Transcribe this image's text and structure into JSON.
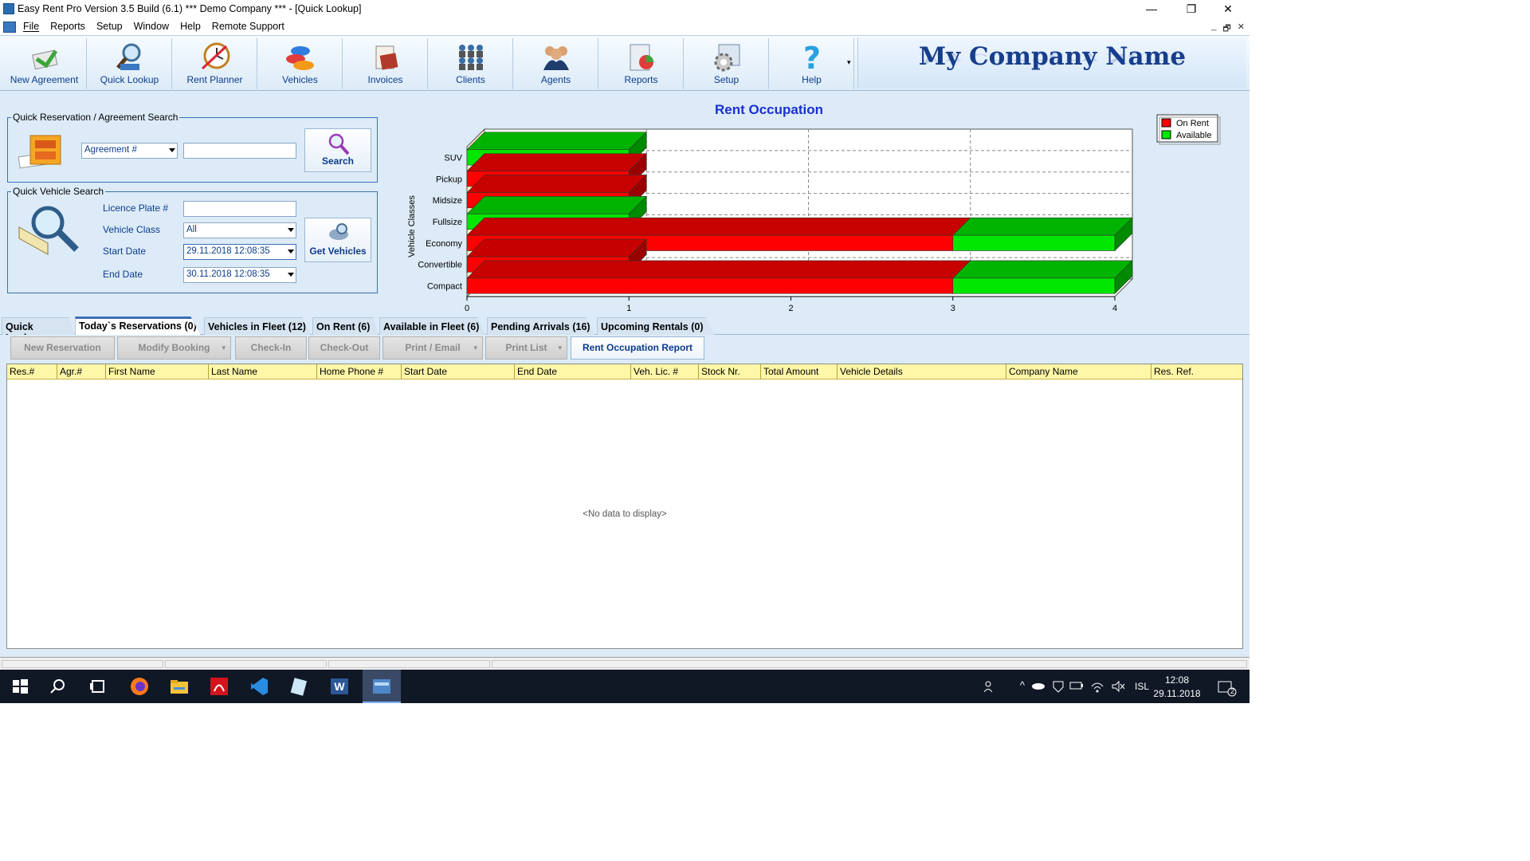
{
  "window": {
    "title": "Easy Rent Pro  Version 3.5 Build (6.1)  *** Demo Company *** - [Quick Lookup]",
    "min": "—",
    "max": "❐",
    "close": "✕"
  },
  "menu": [
    "File",
    "Reports",
    "Setup",
    "Window",
    "Help",
    "Remote Support"
  ],
  "mdi_controls": [
    "_",
    "🗗",
    "✕"
  ],
  "toolbar": {
    "buttons": [
      {
        "label": "New Agreement",
        "icon": "new-agreement-icon"
      },
      {
        "label": "Quick Lookup",
        "icon": "quick-lookup-icon"
      },
      {
        "label": "Rent Planner",
        "icon": "rent-planner-icon"
      },
      {
        "label": "Vehicles",
        "icon": "vehicles-icon"
      },
      {
        "label": "Invoices",
        "icon": "invoices-icon"
      },
      {
        "label": "Clients",
        "icon": "clients-icon"
      },
      {
        "label": "Agents",
        "icon": "agents-icon"
      },
      {
        "label": "Reports",
        "icon": "reports-icon"
      },
      {
        "label": "Setup",
        "icon": "setup-icon"
      },
      {
        "label": "Help",
        "icon": "help-icon"
      }
    ],
    "overflow": "▾",
    "company_name": "My Company Name"
  },
  "quick_search": {
    "legend": "Quick Reservation / Agreement Search",
    "type_value": "Agreement #",
    "search_value": "",
    "search_button": "Search"
  },
  "vehicle_search": {
    "legend": "Quick  Vehicle Search",
    "licence_label": "Licence Plate #",
    "licence_value": "",
    "class_label": "Vehicle Class",
    "class_value": "All",
    "start_label": "Start Date",
    "start_value": "29.11.2018 12:08:35",
    "end_label": "End Date",
    "end_value": "30.11.2018 12:08:35",
    "get_button": "Get Vehicles"
  },
  "chart_data": {
    "type": "bar",
    "orientation": "horizontal",
    "stacked": true,
    "title": "Rent Occupation",
    "ylabel": "Vehicle Classes",
    "xlabel": "",
    "categories": [
      "SUV",
      "Pickup",
      "Midsize",
      "Fullsize",
      "Economy",
      "Convertible",
      "Compact"
    ],
    "series": [
      {
        "name": "On Rent",
        "color": "#ff0000",
        "values": [
          0,
          1,
          1,
          0,
          3,
          1,
          3
        ]
      },
      {
        "name": "Available",
        "color": "#00e600",
        "values": [
          1,
          0,
          0,
          1,
          1,
          0,
          1
        ]
      }
    ],
    "xlim": [
      0,
      4
    ],
    "xticks": [
      "0",
      "1",
      "2",
      "3",
      "4"
    ],
    "grid": true,
    "legend_position": "top-right"
  },
  "tabs": [
    {
      "label": "Quick Lookup",
      "active": false
    },
    {
      "label": "Today`s Reservations (0)",
      "active": true
    },
    {
      "label": "Vehicles in Fleet (12)",
      "active": false
    },
    {
      "label": "On Rent (6)",
      "active": false
    },
    {
      "label": "Available in Fleet (6)",
      "active": false
    },
    {
      "label": "Pending Arrivals (16)",
      "active": false
    },
    {
      "label": "Upcoming Rentals (0)",
      "active": false
    }
  ],
  "actions": [
    {
      "label": "New Reservation",
      "enabled": false,
      "dropdown": false
    },
    {
      "label": "Modify Booking",
      "enabled": false,
      "dropdown": true
    },
    {
      "label": "Check-In",
      "enabled": false,
      "dropdown": false
    },
    {
      "label": "Check-Out",
      "enabled": false,
      "dropdown": false
    },
    {
      "label": "Print / Email",
      "enabled": false,
      "dropdown": true
    },
    {
      "label": "Print List",
      "enabled": false,
      "dropdown": true
    },
    {
      "label": "Rent Occupation Report",
      "enabled": true,
      "dropdown": false
    }
  ],
  "grid": {
    "columns": [
      "Res.#",
      "Agr.#",
      "First Name",
      "Last Name",
      "Home Phone #",
      "Start Date",
      "End Date",
      "Veh. Lic. #",
      "Stock Nr.",
      "Total Amount",
      "Vehicle Details",
      "Company Name",
      "Res. Ref."
    ],
    "rows": [],
    "empty_text": "<No data to display>"
  },
  "taskbar": {
    "apps": [
      "windows-start-icon",
      "search-icon",
      "task-view-icon",
      "firefox-icon",
      "file-explorer-icon",
      "acrobat-icon",
      "vscode-icon",
      "notepad-icon",
      "word-icon",
      "easy-rent-icon"
    ],
    "lang": "ISL",
    "time": "12:08",
    "date": "29.11.2018",
    "notifications": "2"
  }
}
